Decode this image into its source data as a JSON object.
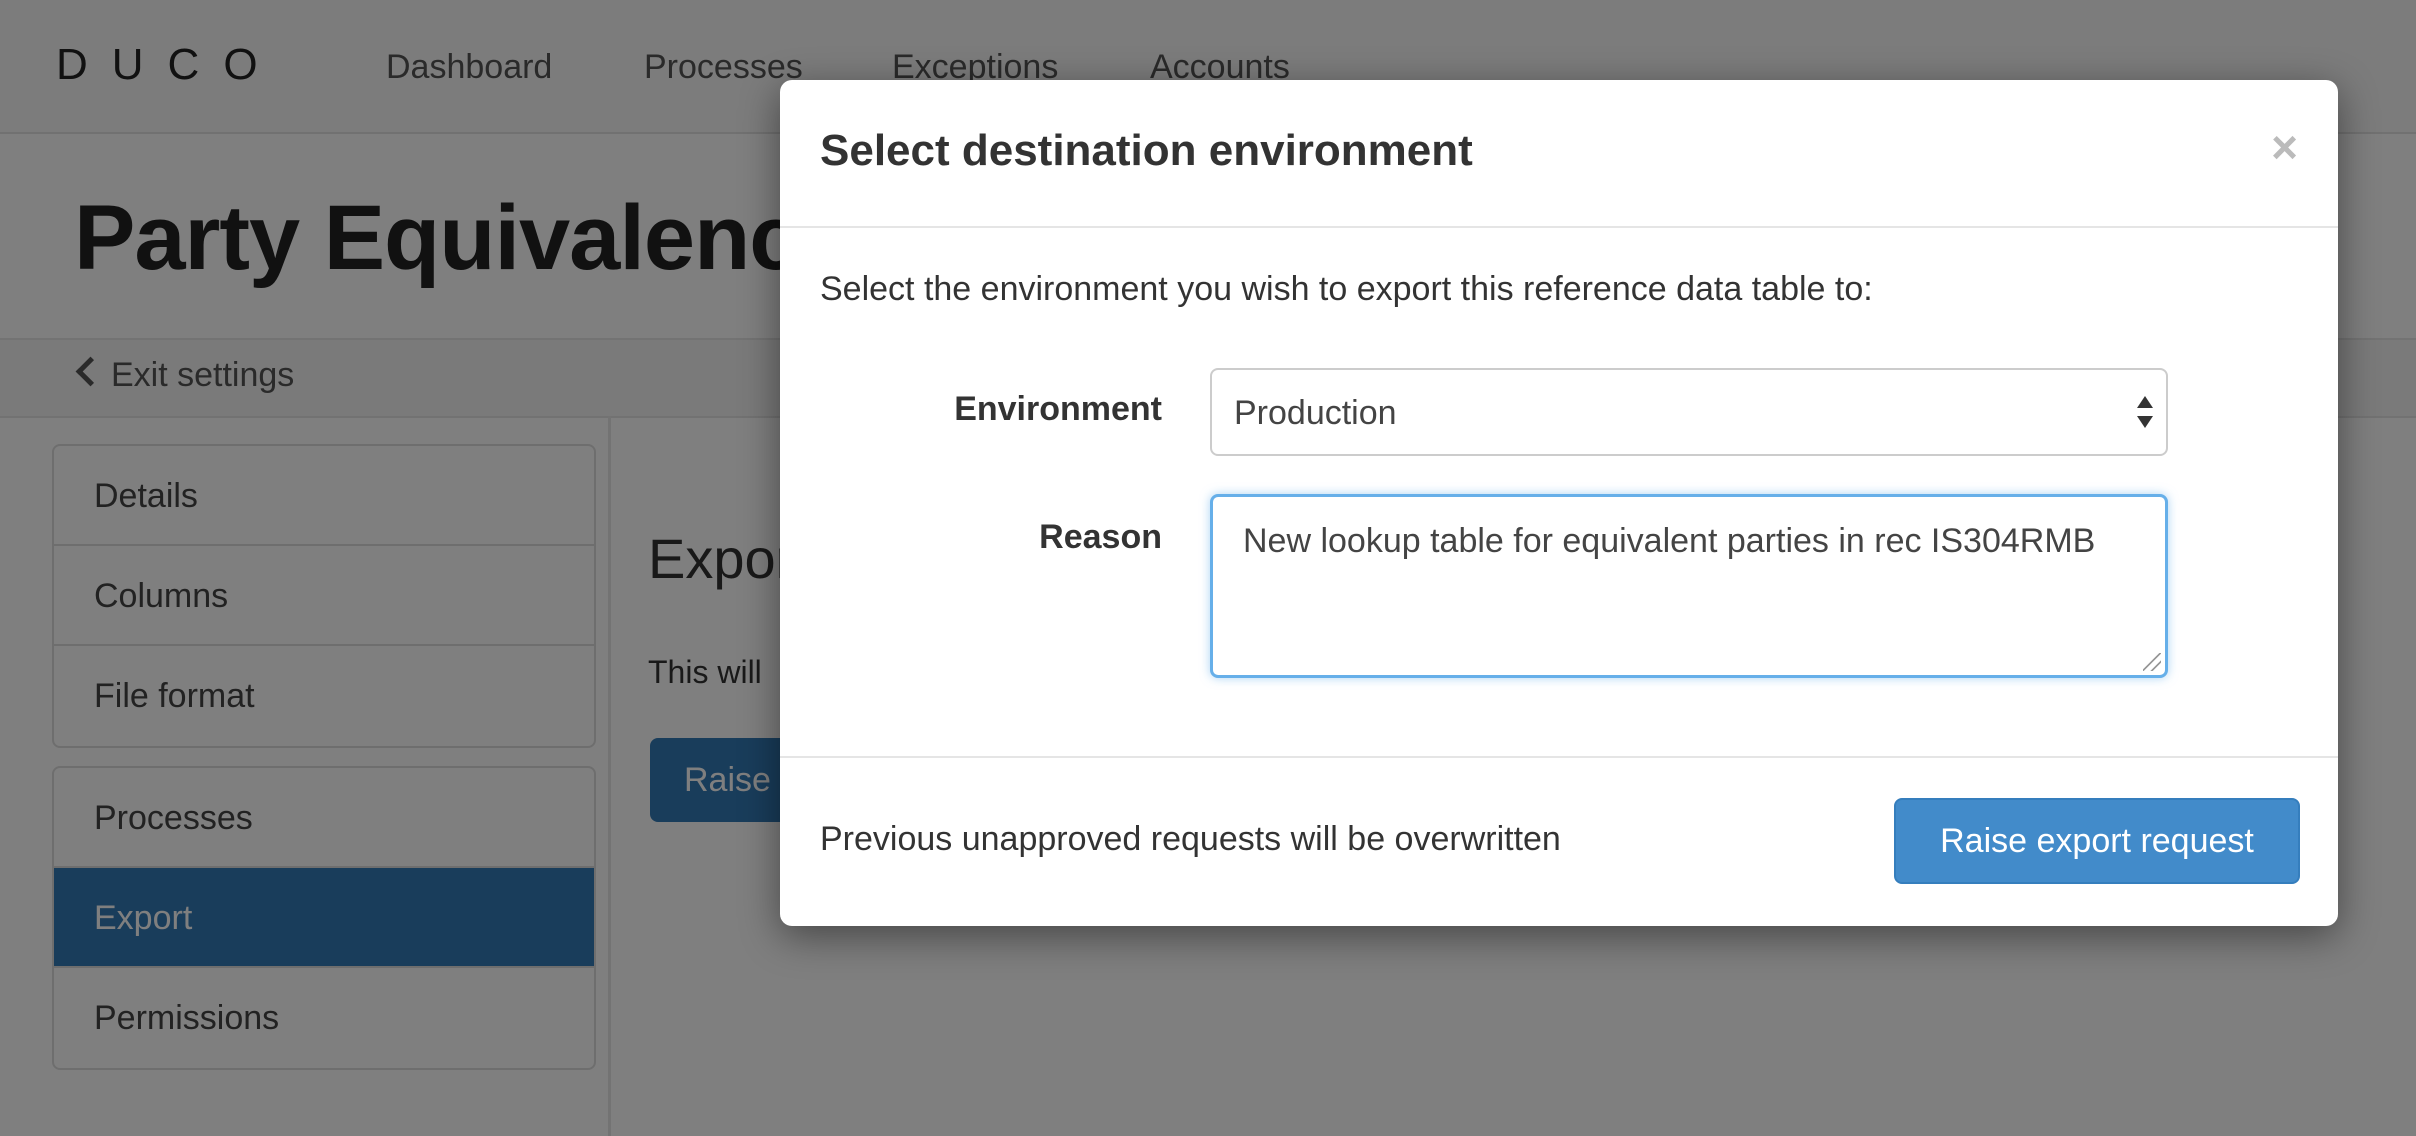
{
  "app": {
    "logo_text": "DUCO"
  },
  "nav": {
    "items": [
      "Dashboard",
      "Processes",
      "Exceptions",
      "Accounts"
    ]
  },
  "page": {
    "title": "Party Equivalence",
    "exit_label": "Exit settings"
  },
  "sidebar": {
    "group1": [
      "Details",
      "Columns",
      "File format"
    ],
    "group2": [
      "Processes",
      "Export",
      "Permissions"
    ],
    "active": "Export"
  },
  "main": {
    "heading": "Export",
    "text": "This will",
    "button_label": "Raise"
  },
  "modal": {
    "title": "Select destination environment",
    "close_label": "×",
    "intro": "Select the environment you wish to export this reference data table to:",
    "environment_label": "Environment",
    "environment_value": "Production",
    "reason_label": "Reason",
    "reason_value": "New lookup table for equivalent parties in rec IS304RMB",
    "footer_note": "Previous unapproved requests will be overwritten",
    "submit_label": "Raise export request"
  },
  "colors": {
    "accent": "#337ab7",
    "primary_button": "#428bca",
    "focus": "#66afe9"
  }
}
